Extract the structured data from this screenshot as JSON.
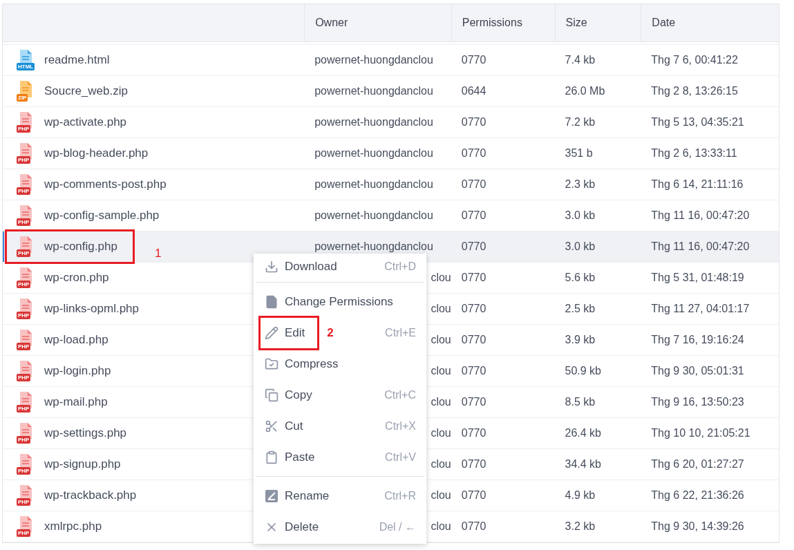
{
  "table": {
    "columns": [
      "",
      "Owner",
      "Permissions",
      "Size",
      "Date"
    ],
    "rows": [
      {
        "kind": "html",
        "badge": "HTML",
        "name": "readme.html",
        "owner": "powernet-huongdanclou",
        "covered": false,
        "permissions": "0770",
        "size": "7.4 kb",
        "date": "Thg 7 6, 00:41:22",
        "selected": false
      },
      {
        "kind": "zip",
        "badge": "ZIP",
        "name": "Soucre_web.zip",
        "owner": "powernet-huongdanclou",
        "covered": false,
        "permissions": "0644",
        "size": "26.0 Mb",
        "date": "Thg 2 8, 13:26:15",
        "selected": false
      },
      {
        "kind": "php",
        "badge": "PHP",
        "name": "wp-activate.php",
        "owner": "powernet-huongdanclou",
        "covered": false,
        "permissions": "0770",
        "size": "7.2 kb",
        "date": "Thg 5 13, 04:35:21",
        "selected": false
      },
      {
        "kind": "php",
        "badge": "PHP",
        "name": "wp-blog-header.php",
        "owner": "powernet-huongdanclou",
        "covered": false,
        "permissions": "0770",
        "size": "351 b",
        "date": "Thg 2 6, 13:33:11",
        "selected": false
      },
      {
        "kind": "php",
        "badge": "PHP",
        "name": "wp-comments-post.php",
        "owner": "powernet-huongdanclou",
        "covered": false,
        "permissions": "0770",
        "size": "2.3 kb",
        "date": "Thg 6 14, 21:11:16",
        "selected": false
      },
      {
        "kind": "php",
        "badge": "PHP",
        "name": "wp-config-sample.php",
        "owner": "powernet-huongdanclou",
        "covered": false,
        "permissions": "0770",
        "size": "3.0 kb",
        "date": "Thg 11 16, 00:47:20",
        "selected": false
      },
      {
        "kind": "php",
        "badge": "PHP",
        "name": "wp-config.php",
        "owner": "powernet-huongdanclou",
        "covered": false,
        "permissions": "0770",
        "size": "3.0 kb",
        "date": "Thg 11 16, 00:47:20",
        "selected": true,
        "annotation": "1"
      },
      {
        "kind": "php",
        "badge": "PHP",
        "name": "wp-cron.php",
        "owner": "clou",
        "covered": true,
        "permissions": "0770",
        "size": "5.6 kb",
        "date": "Thg 5 31, 01:48:19",
        "selected": false
      },
      {
        "kind": "php",
        "badge": "PHP",
        "name": "wp-links-opml.php",
        "owner": "clou",
        "covered": true,
        "permissions": "0770",
        "size": "2.5 kb",
        "date": "Thg 11 27, 04:01:17",
        "selected": false
      },
      {
        "kind": "php",
        "badge": "PHP",
        "name": "wp-load.php",
        "owner": "clou",
        "covered": true,
        "permissions": "0770",
        "size": "3.9 kb",
        "date": "Thg 7 16, 19:16:24",
        "selected": false
      },
      {
        "kind": "php",
        "badge": "PHP",
        "name": "wp-login.php",
        "owner": "clou",
        "covered": true,
        "permissions": "0770",
        "size": "50.9 kb",
        "date": "Thg 9 30, 05:01:31",
        "selected": false
      },
      {
        "kind": "php",
        "badge": "PHP",
        "name": "wp-mail.php",
        "owner": "clou",
        "covered": true,
        "permissions": "0770",
        "size": "8.5 kb",
        "date": "Thg 9 16, 13:50:23",
        "selected": false
      },
      {
        "kind": "php",
        "badge": "PHP",
        "name": "wp-settings.php",
        "owner": "clou",
        "covered": true,
        "permissions": "0770",
        "size": "26.4 kb",
        "date": "Thg 10 10, 21:05:21",
        "selected": false
      },
      {
        "kind": "php",
        "badge": "PHP",
        "name": "wp-signup.php",
        "owner": "clou",
        "covered": true,
        "permissions": "0770",
        "size": "34.4 kb",
        "date": "Thg 6 20, 01:27:27",
        "selected": false
      },
      {
        "kind": "php",
        "badge": "PHP",
        "name": "wp-trackback.php",
        "owner": "clou",
        "covered": true,
        "permissions": "0770",
        "size": "4.9 kb",
        "date": "Thg 6 22, 21:36:26",
        "selected": false
      },
      {
        "kind": "php",
        "badge": "PHP",
        "name": "xmlrpc.php",
        "owner": "clou",
        "covered": true,
        "permissions": "0770",
        "size": "3.2 kb",
        "date": "Thg 9 30, 14:39:26",
        "selected": false
      }
    ]
  },
  "context_menu": {
    "items": [
      {
        "kind": "download",
        "label": "Download",
        "shortcut": "Ctrl+D",
        "divider_after": true
      },
      {
        "kind": "permissions",
        "label": "Change Permissions",
        "divider_after": false
      },
      {
        "kind": "edit",
        "label": "Edit",
        "shortcut": "Ctrl+E",
        "divider_after": false,
        "annotation": "2"
      },
      {
        "kind": "compress",
        "label": "Compress",
        "divider_after": false
      },
      {
        "kind": "copy",
        "label": "Copy",
        "shortcut": "Ctrl+C",
        "divider_after": false
      },
      {
        "kind": "cut",
        "label": "Cut",
        "shortcut": "Ctrl+X",
        "divider_after": false
      },
      {
        "kind": "paste",
        "label": "Paste",
        "shortcut": "Ctrl+V",
        "divider_after": true
      },
      {
        "kind": "rename",
        "label": "Rename",
        "shortcut": "Ctrl+R",
        "divider_after": false
      },
      {
        "kind": "delete",
        "label": "Delete",
        "shortcut": "Del / ←",
        "divider_after": false
      }
    ]
  }
}
